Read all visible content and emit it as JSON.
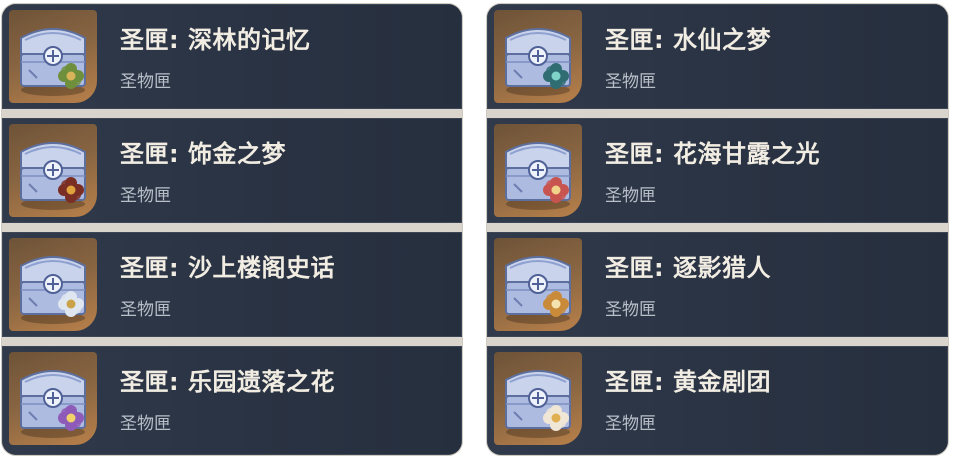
{
  "left_column": [
    {
      "title": "圣匣: 深林的记忆",
      "subtitle": "圣物匣",
      "flower_color": "#6f8f3c",
      "flower_center": "#d9b45a"
    },
    {
      "title": "圣匣: 饰金之梦",
      "subtitle": "圣物匣",
      "flower_color": "#7a2e24",
      "flower_center": "#e0a23c"
    },
    {
      "title": "圣匣: 沙上楼阁史话",
      "subtitle": "圣物匣",
      "flower_color": "#dfe6f0",
      "flower_center": "#c9a24a"
    },
    {
      "title": "圣匣: 乐园遗落之花",
      "subtitle": "圣物匣",
      "flower_color": "#8e5bb8",
      "flower_center": "#f2d36a"
    }
  ],
  "right_column": [
    {
      "title": "圣匣: 水仙之梦",
      "subtitle": "圣物匣",
      "flower_color": "#2f6d73",
      "flower_center": "#7fd3c8"
    },
    {
      "title": "圣匣: 花海甘露之光",
      "subtitle": "圣物匣",
      "flower_color": "#c8544f",
      "flower_center": "#f0d28a"
    },
    {
      "title": "圣匣: 逐影猎人",
      "subtitle": "圣物匣",
      "flower_color": "#c98a3a",
      "flower_center": "#f4e2b0"
    },
    {
      "title": "圣匣: 黄金剧团",
      "subtitle": "圣物匣",
      "flower_color": "#f0e6d6",
      "flower_center": "#e0b050"
    }
  ],
  "icons": {
    "item_icon": "chest-with-flower-icon"
  }
}
